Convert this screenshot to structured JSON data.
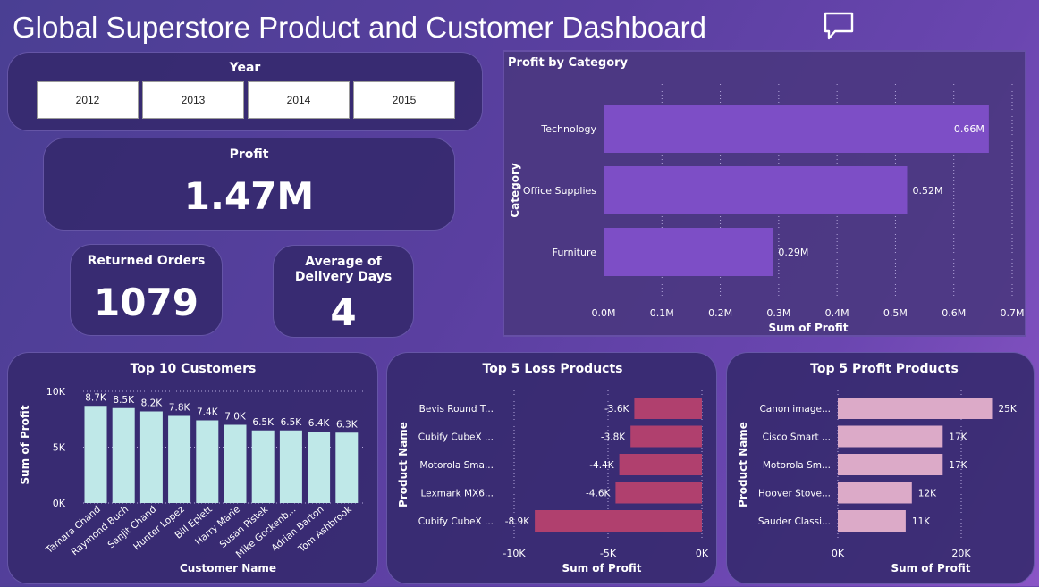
{
  "title": "Global Superstore Product and Customer Dashboard",
  "icons": {
    "comment": "speech-bubble-icon"
  },
  "colors": {
    "category_bar": "#7d4ec6",
    "customer_bar": "#bfe8e8",
    "loss_bar": "#b0406e",
    "profit_bar": "#dcaac8"
  },
  "year_slicer": {
    "label": "Year",
    "options": [
      "2012",
      "2013",
      "2014",
      "2015"
    ]
  },
  "kpis": {
    "profit": {
      "label": "Profit",
      "value": "1.47M"
    },
    "returned_orders": {
      "label": "Returned Orders",
      "value": "1079"
    },
    "avg_delivery": {
      "label": "Average of Delivery Days",
      "value": "4"
    }
  },
  "chart_data": [
    {
      "id": "profit_by_category",
      "type": "bar",
      "orientation": "horizontal",
      "title": "Profit by Category",
      "xlabel": "Sum of Profit",
      "ylabel": "Category",
      "categories": [
        "Technology",
        "Office Supplies",
        "Furniture"
      ],
      "values": [
        0.66,
        0.52,
        0.29
      ],
      "data_labels": [
        "0.66M",
        "0.52M",
        "0.29M"
      ],
      "xlim": [
        0,
        0.7
      ],
      "xticks": [
        "0.0M",
        "0.1M",
        "0.2M",
        "0.3M",
        "0.4M",
        "0.5M",
        "0.6M",
        "0.7M"
      ],
      "grid": true
    },
    {
      "id": "top_customers",
      "type": "bar",
      "orientation": "vertical",
      "title": "Top 10 Customers",
      "xlabel": "Customer Name",
      "ylabel": "Sum of Profit",
      "categories": [
        "Tamara Chand",
        "Raymond Buch",
        "Sanjit Chand",
        "Hunter Lopez",
        "Bill Eplett",
        "Harry Marie",
        "Susan Pistek",
        "Mike Gockenb...",
        "Adrian Barton",
        "Tom Ashbrook"
      ],
      "values": [
        8.7,
        8.5,
        8.2,
        7.8,
        7.4,
        7.0,
        6.5,
        6.5,
        6.4,
        6.3
      ],
      "data_labels": [
        "8.7K",
        "8.5K",
        "8.2K",
        "7.8K",
        "7.4K",
        "7.0K",
        "6.5K",
        "6.5K",
        "6.4K",
        "6.3K"
      ],
      "ylim": [
        0,
        10
      ],
      "yticks": [
        "0K",
        "5K",
        "10K"
      ],
      "grid": true
    },
    {
      "id": "top_loss_products",
      "type": "bar",
      "orientation": "horizontal",
      "title": "Top 5 Loss Products",
      "xlabel": "Sum of Profit",
      "ylabel": "Product Name",
      "categories": [
        "Bevis Round T...",
        "Cubify CubeX ...",
        "Motorola Sma...",
        "Lexmark MX6...",
        "Cubify CubeX ..."
      ],
      "values": [
        -3.6,
        -3.8,
        -4.4,
        -4.6,
        -8.9
      ],
      "data_labels": [
        "-3.6K",
        "-3.8K",
        "-4.4K",
        "-4.6K",
        "-8.9K"
      ],
      "xlim": [
        -10,
        0
      ],
      "xticks": [
        "-10K",
        "-5K",
        "0K"
      ],
      "grid": true
    },
    {
      "id": "top_profit_products",
      "type": "bar",
      "orientation": "horizontal",
      "title": "Top 5 Profit Products",
      "xlabel": "Sum of Profit",
      "ylabel": "Product Name",
      "categories": [
        "Canon image...",
        "Cisco Smart ...",
        "Motorola Sm...",
        "Hoover Stove...",
        "Sauder Classi..."
      ],
      "values": [
        25,
        17,
        17,
        12,
        11
      ],
      "data_labels": [
        "25K",
        "17K",
        "17K",
        "12K",
        "11K"
      ],
      "xlim": [
        0,
        20
      ],
      "xticks": [
        "0K",
        "20K"
      ],
      "grid": true
    }
  ]
}
